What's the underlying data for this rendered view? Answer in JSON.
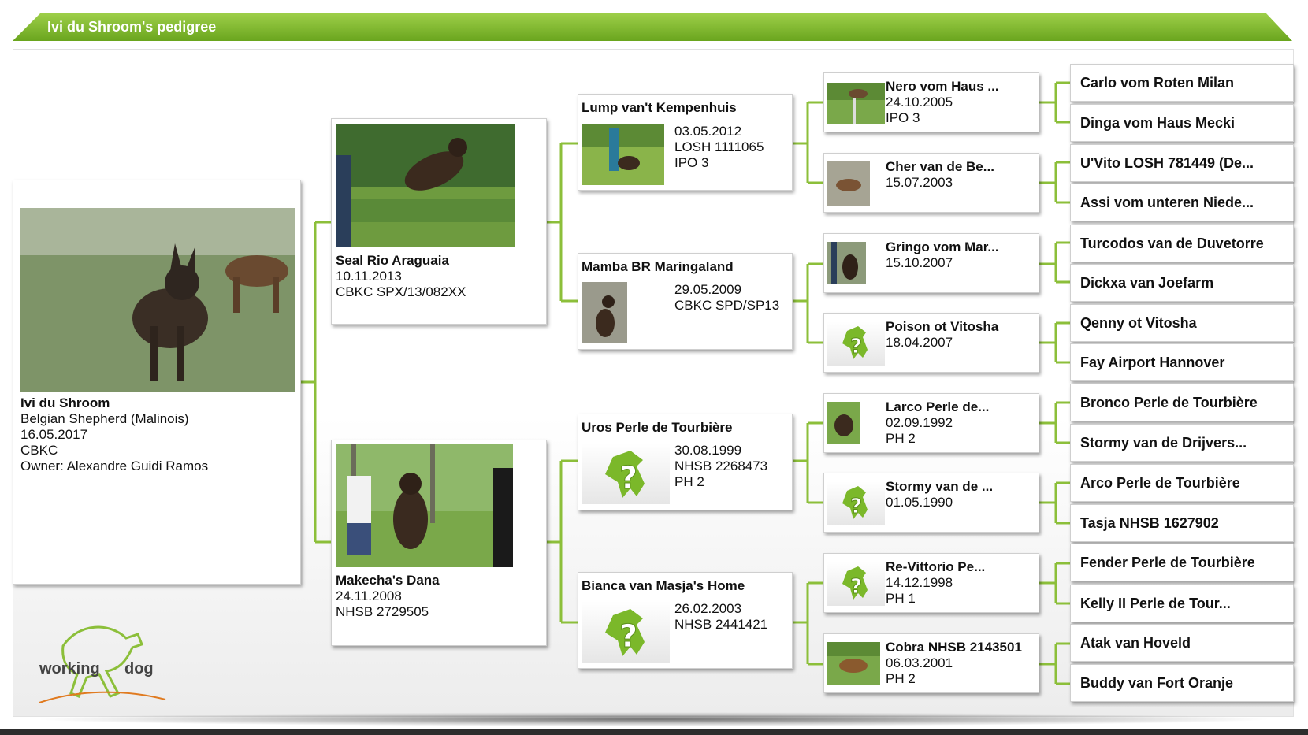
{
  "header": {
    "title": "Ivi du Shroom's pedigree"
  },
  "logo": {
    "text_left": "working",
    "text_right": "dog"
  },
  "subject": {
    "name": "Ivi du Shroom",
    "breed": "Belgian Shepherd (Malinois)",
    "dob": "16.05.2017",
    "registry": "CBKC",
    "owner": "Owner: Alexandre Guidi Ramos"
  },
  "gen1": [
    {
      "name": "Seal Rio Araguaia",
      "date": "10.11.2013",
      "reg": "CBKC SPX/13/082XX"
    },
    {
      "name": "Makecha's Dana",
      "date": "24.11.2008",
      "reg": "NHSB 2729505"
    }
  ],
  "gen2": [
    {
      "name": "Lump van't Kempenhuis",
      "date": "03.05.2012",
      "reg": "LOSH 1111065",
      "title": "IPO 3"
    },
    {
      "name": "Mamba BR Maringaland",
      "date": "29.05.2009",
      "reg": "CBKC SPD/SP13",
      "title": ""
    },
    {
      "name": "Uros Perle de Tourbière",
      "date": "30.08.1999",
      "reg": "NHSB 2268473",
      "title": "PH 2"
    },
    {
      "name": "Bianca van Masja's Home",
      "date": "26.02.2003",
      "reg": " NHSB 2441421",
      "title": ""
    }
  ],
  "gen3": [
    {
      "name": "Nero vom Haus ...",
      "date": "24.10.2005",
      "extra": "IPO 3"
    },
    {
      "name": "Cher van de Be...",
      "date": "15.07.2003",
      "extra": ""
    },
    {
      "name": "Gringo vom Mar...",
      "date": "15.10.2007",
      "extra": ""
    },
    {
      "name": "Poison ot Vitosha",
      "date": "18.04.2007",
      "extra": ""
    },
    {
      "name": "Larco Perle de...",
      "date": "02.09.1992",
      "extra": "PH 2"
    },
    {
      "name": "Stormy van de ...",
      "date": "01.05.1990",
      "extra": ""
    },
    {
      "name": "Re-Vittorio Pe...",
      "date": "14.12.1998",
      "extra": "PH 1"
    },
    {
      "name": "Cobra NHSB 2143501",
      "date": "06.03.2001",
      "extra": "PH 2"
    }
  ],
  "gen4": [
    "Carlo vom Roten Milan",
    "Dinga vom Haus Mecki",
    "U'Vito LOSH 781449 (De...",
    "Assi vom unteren Niede...",
    "Turcodos van de Duvetorre",
    "Dickxa van Joefarm",
    "Qenny ot Vitosha",
    "Fay Airport Hannover",
    "Bronco Perle de Tourbière",
    "Stormy van de Drijvers...",
    "Arco Perle de Tourbière",
    "Tasja NHSB 1627902",
    "Fender Perle de Tourbière",
    "Kelly II Perle de Tour...",
    "Atak van Hoveld",
    "Buddy van Fort Oranje"
  ],
  "colors": {
    "accent": "#7bb82a",
    "header_top": "#9fd04a",
    "header_bottom": "#6aa51e",
    "line": "#8cbf3a"
  }
}
